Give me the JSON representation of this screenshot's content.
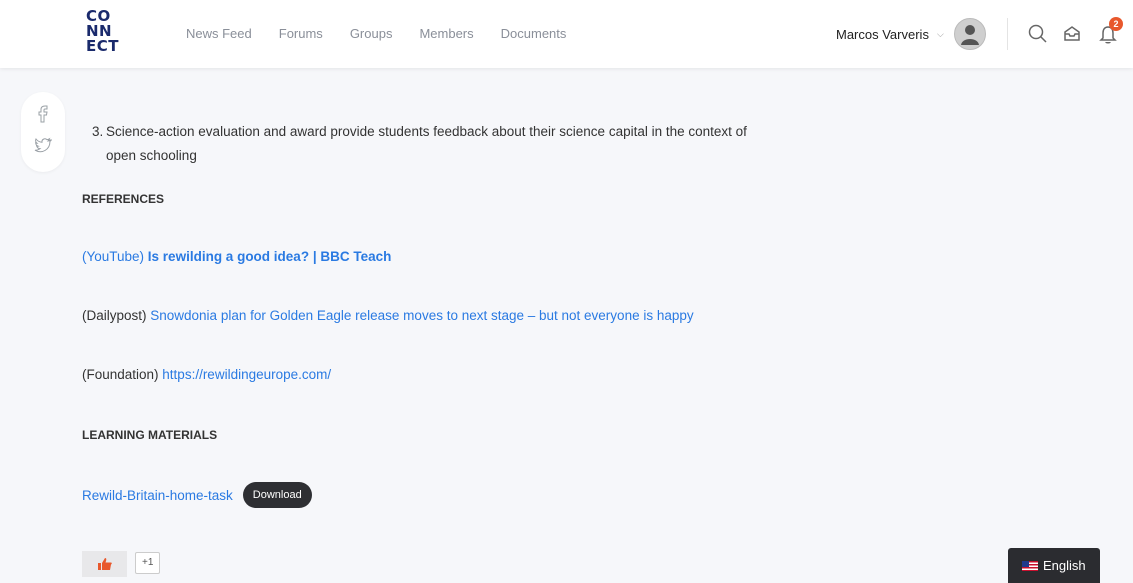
{
  "brand": {
    "logo_lines": [
      "CO",
      "NN",
      "ECT"
    ]
  },
  "nav": [
    "News Feed",
    "Forums",
    "Groups",
    "Members",
    "Documents"
  ],
  "user": {
    "name": "Marcos Varveris"
  },
  "notifications": {
    "count": "2"
  },
  "share": {
    "icons": [
      "facebook-icon",
      "twitter-icon"
    ]
  },
  "content": {
    "step_number": "3.",
    "step_line1": "Science-action evaluation and award provide students feedback about their science capital in the context of",
    "step_line2": "open schooling",
    "references_heading": "REFERENCES",
    "references": [
      {
        "source": "(YouTube) ",
        "link": "Is rewilding a good idea? | BBC Teach"
      },
      {
        "source": "(Dailypost) ",
        "link": "Snowdonia plan for Golden Eagle release moves to next stage – but not everyone is happy"
      },
      {
        "source": "(Foundation) ",
        "link": "https://rewildingeurope.com/"
      }
    ],
    "materials_heading": "LEARNING MATERIALS",
    "material_link": "Rewild-Britain-home-task",
    "download_label": "Download"
  },
  "reactions": {
    "count": "+1"
  },
  "language": {
    "label": "English"
  },
  "colors": {
    "link": "#2a7ae2",
    "badge": "#e8582c",
    "dark": "#2e2f33"
  }
}
